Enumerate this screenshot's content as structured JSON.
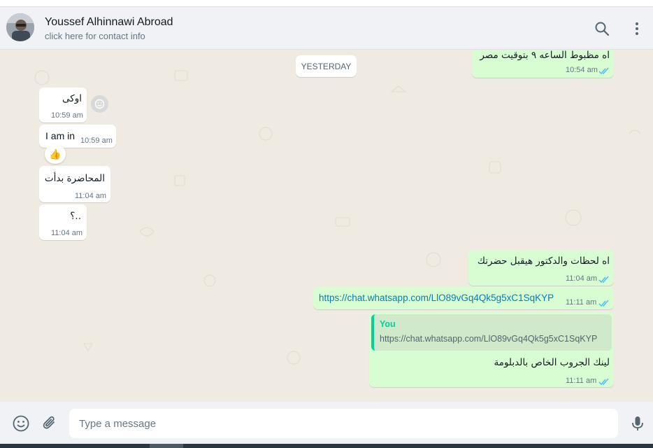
{
  "header": {
    "contact_name": "Youssef Alhinnawi Abroad",
    "subtitle": "click here for contact info",
    "icons": [
      "search-icon",
      "menu-icon"
    ]
  },
  "chat": {
    "day_divider": "YESTERDAY",
    "messages": [
      {
        "direction": "outgoing",
        "text": "اه مظبوط الساعه ٩ بتوقيت مصر",
        "time": "10:54 am",
        "status": "read"
      },
      {
        "direction": "incoming",
        "text": "اوكى",
        "time": "10:59 am"
      },
      {
        "direction": "incoming",
        "text": "I am in",
        "time": "10:59 am",
        "reaction": "👍"
      },
      {
        "direction": "incoming",
        "text": "المحاضرة بدأت",
        "time": "11:04 am"
      },
      {
        "direction": "incoming",
        "text": "..؟",
        "time": "11:04 am"
      },
      {
        "direction": "outgoing",
        "text": "اه لحظات والدكتور هيقبل حضرتك",
        "time": "11:04 am",
        "status": "read"
      },
      {
        "direction": "outgoing",
        "text": "https://chat.whatsapp.com/LlO89vGq4Qk5g5xC1SqKYP",
        "time": "11:11 am",
        "status": "read"
      },
      {
        "direction": "outgoing",
        "quote_author": "You",
        "quote_text": "https://chat.whatsapp.com/LlO89vGq4Qk5g5xC1SqKYP",
        "text": "لينك الجروب الخاص بالدبلومة",
        "time": "11:11 am",
        "status": "read"
      }
    ]
  },
  "footer": {
    "placeholder": "Type a message",
    "value": "",
    "icons": [
      "emoji-icon",
      "attach-icon",
      "mic-icon"
    ]
  },
  "colors": {
    "outgoing_bubble": "#d9fdd3",
    "incoming_bubble": "#ffffff",
    "chat_background": "#efeae2",
    "read_ticks": "#53bdeb",
    "link": "#027eb5",
    "quote_accent": "#06cf9c"
  }
}
